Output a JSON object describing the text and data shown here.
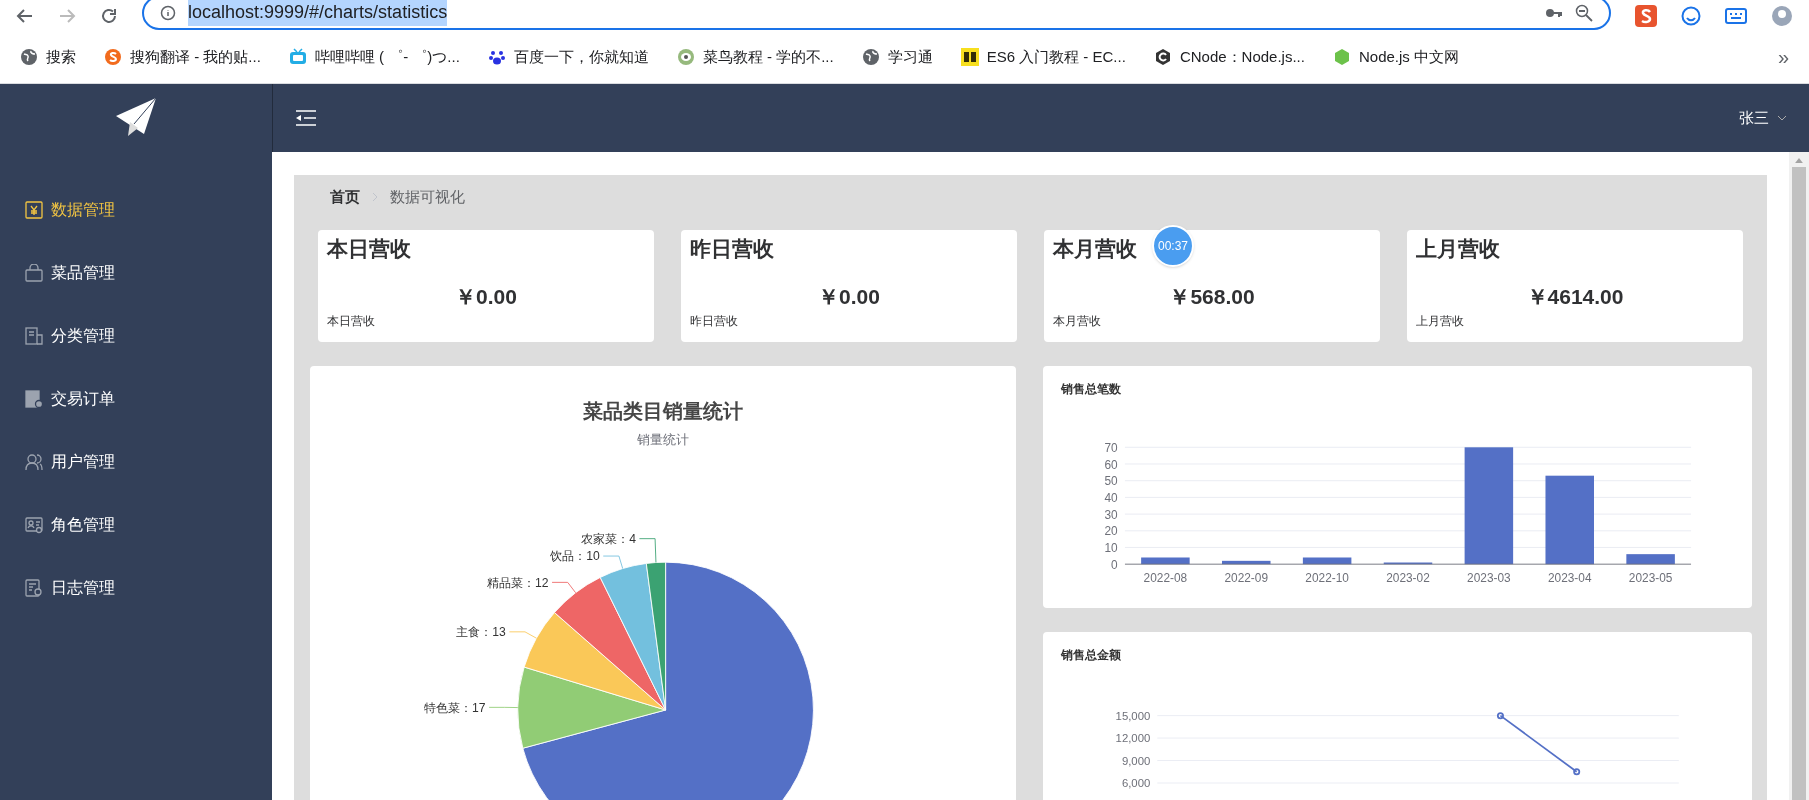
{
  "browser": {
    "address": "localhost:9999/#/charts/statistics",
    "bookmarks": [
      {
        "label": "搜索"
      },
      {
        "label": "搜狗翻译 - 我的贴..."
      },
      {
        "label": "哔哩哔哩 ( ゜- ゜)つ..."
      },
      {
        "label": "百度一下，你就知道"
      },
      {
        "label": "菜鸟教程 - 学的不..."
      },
      {
        "label": "学习通"
      },
      {
        "label": "ES6 入门教程 - EC..."
      },
      {
        "label": "CNode：Node.js..."
      },
      {
        "label": "Node.js 中文网"
      }
    ],
    "more": "»"
  },
  "sidebar": {
    "items": [
      {
        "label": "数据管理",
        "selected": true
      },
      {
        "label": "菜品管理",
        "selected": false
      },
      {
        "label": "分类管理",
        "selected": false
      },
      {
        "label": "交易订单",
        "selected": false
      },
      {
        "label": "用户管理",
        "selected": false
      },
      {
        "label": "角色管理",
        "selected": false
      },
      {
        "label": "日志管理",
        "selected": false
      }
    ]
  },
  "header": {
    "user": "张三"
  },
  "breadcrumb": [
    "首页",
    "数据可视化"
  ],
  "timer": "00:37",
  "cards": [
    {
      "title": "本日营收",
      "amount": "￥0.00",
      "caption": "本日营收"
    },
    {
      "title": "昨日营收",
      "amount": "￥0.00",
      "caption": "昨日营收"
    },
    {
      "title": "本月营收",
      "amount": "￥568.00",
      "caption": "本月营收"
    },
    {
      "title": "上月营收",
      "amount": "￥4614.00",
      "caption": "上月营收"
    }
  ],
  "pie": {
    "chart_data": {
      "type": "pie",
      "title": "菜品类目销量统计",
      "subtitle": "销量统计",
      "values": [
        136,
        17,
        13,
        12,
        10,
        4
      ],
      "colors": [
        "#5470c6",
        "#91cc75",
        "#fac858",
        "#ee6666",
        "#73c0de",
        "#3ba272"
      ],
      "value_labels": [
        null,
        "特色菜：17",
        "主食：13",
        "精品菜：12",
        "饮品：10",
        "农家菜：4"
      ]
    }
  },
  "bar": {
    "chart_data": {
      "type": "bar",
      "title": "销售总笔数",
      "categories": [
        "2022-08",
        "2022-09",
        "2022-10",
        "2023-02",
        "2023-03",
        "2023-04",
        "2023-05"
      ],
      "values": [
        4,
        2,
        4,
        1,
        70,
        53,
        6
      ],
      "ylim": [
        0,
        70
      ],
      "yticks": [
        0,
        10,
        20,
        30,
        40,
        50,
        60,
        70
      ],
      "grid": true
    }
  },
  "line": {
    "chart_data": {
      "type": "line",
      "title": "销售总金额",
      "series": [
        {
          "color": "#5470c6",
          "values": [
            null,
            null,
            null,
            null,
            15000,
            7500,
            null
          ],
          "marker": true
        }
      ],
      "ylim": [
        6000,
        15000
      ],
      "grid": true,
      "yticks": [
        {
          "value": 6000,
          "label": "6,000"
        },
        {
          "value": 9000,
          "label": "9,000"
        },
        {
          "value": 12000,
          "label": "12,000"
        },
        {
          "value": 15000,
          "label": "15,000"
        }
      ]
    }
  }
}
